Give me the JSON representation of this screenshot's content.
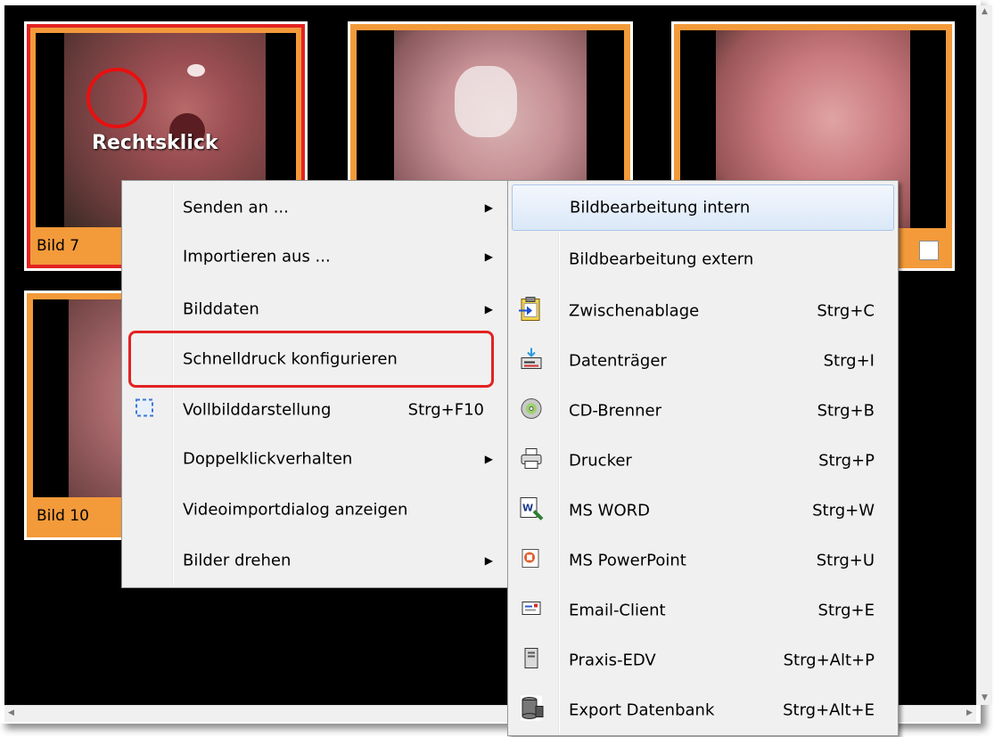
{
  "thumbnails": [
    {
      "label": "Bild 7",
      "selected": true
    },
    {
      "label": "",
      "selected": false
    },
    {
      "label": "",
      "selected": false,
      "checkbox": true
    },
    {
      "label": "Bild 10",
      "selected": false
    }
  ],
  "annotation": {
    "right_click_text": "Rechtsklick"
  },
  "context_menu": {
    "items": [
      {
        "label": "Senden an ...",
        "submenu": true
      },
      {
        "label": "Importieren aus ...",
        "submenu": true
      },
      {
        "label": "Bilddaten",
        "submenu": true
      },
      {
        "label": "Schnelldruck konfigurieren",
        "submenu": false,
        "highlighted_box": true
      },
      {
        "label": "Vollbilddarstellung",
        "shortcut": "Strg+F10",
        "icon": "fullscreen-icon"
      },
      {
        "label": "Doppelklickverhalten",
        "submenu": true
      },
      {
        "label": "Videoimportdialog anzeigen",
        "submenu": false
      },
      {
        "label": "Bilder drehen",
        "submenu": true
      }
    ]
  },
  "send_submenu": {
    "items": [
      {
        "label": "Bildbearbeitung intern",
        "hover": true
      },
      {
        "label": "Bildbearbeitung extern"
      },
      {
        "label": "Zwischenablage",
        "shortcut": "Strg+C",
        "icon": "clipboard-icon"
      },
      {
        "label": "Datenträger",
        "shortcut": "Strg+I",
        "icon": "drive-icon"
      },
      {
        "label": "CD-Brenner",
        "shortcut": "Strg+B",
        "icon": "cd-icon"
      },
      {
        "label": "Drucker",
        "shortcut": "Strg+P",
        "icon": "printer-icon"
      },
      {
        "label": "MS WORD",
        "shortcut": "Strg+W",
        "icon": "word-icon"
      },
      {
        "label": "MS PowerPoint",
        "shortcut": "Strg+U",
        "icon": "powerpoint-icon"
      },
      {
        "label": "Email-Client",
        "shortcut": "Strg+E",
        "icon": "email-icon"
      },
      {
        "label": "Praxis-EDV",
        "shortcut": "Strg+Alt+P",
        "icon": "computer-icon"
      },
      {
        "label": "Export Datenbank",
        "shortcut": "Strg+Alt+E",
        "icon": "database-icon"
      }
    ]
  },
  "colors": {
    "tile_orange": "#f39a3a",
    "selected_red": "#e32222",
    "highlight_blue": "#dbe8f8"
  }
}
